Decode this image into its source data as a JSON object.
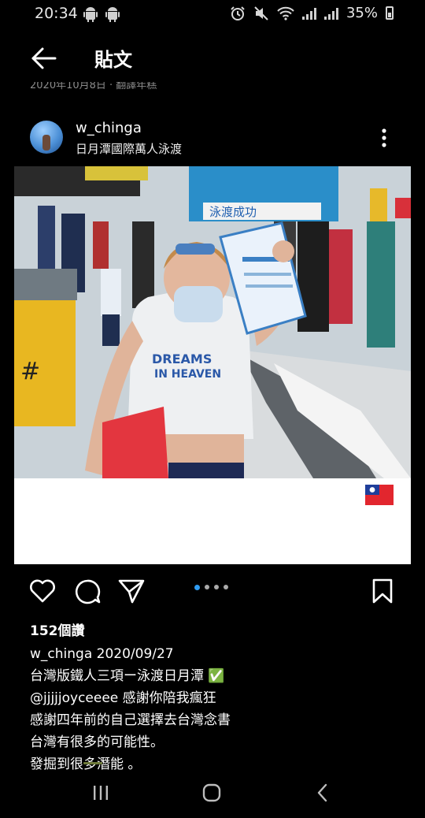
{
  "status": {
    "time": "20:34",
    "battery_pct": "35%"
  },
  "header": {
    "title": "貼文",
    "clipped_subline": "2020年10月8日 · 翻譯年糕"
  },
  "post": {
    "username": "w_chinga",
    "location": "日月潭國際萬人泳渡",
    "photo_banner_text": "泳渡成功",
    "flag_emoji": "🇹🇼",
    "carousel_pages": 4,
    "carousel_active_index": 0,
    "likes": "152個讚",
    "caption": {
      "username": "w_chinga",
      "date": "2020/09/27",
      "line1": "台灣版鐵人三項ー泳渡日月潭 ✅",
      "mention": "@jjjjjoyceeee",
      "line2_rest": " 感謝你陪我瘋狂",
      "line3": "感謝四年前的自己選擇去台灣念書",
      "line4": "台灣有很多的可能性。",
      "line5": "發掘到很多潛能 。"
    }
  },
  "colors": {
    "background": "#000000",
    "carousel_active": "#2f9cf2"
  }
}
